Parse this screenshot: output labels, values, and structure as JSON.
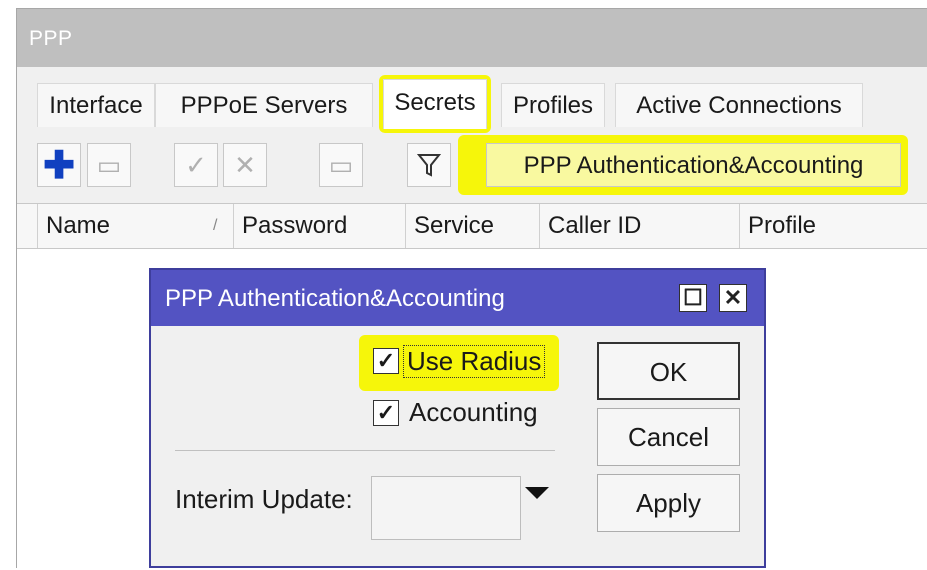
{
  "window": {
    "title": "PPP"
  },
  "tabs": [
    {
      "label": "Interface"
    },
    {
      "label": "PPPoE Servers"
    },
    {
      "label": "Secrets"
    },
    {
      "label": "Profiles"
    },
    {
      "label": "Active Connections"
    }
  ],
  "toolbar": {
    "add_icon": "plus-icon",
    "remove_icon": "minus-icon",
    "enable_icon": "check-icon",
    "disable_icon": "x-icon",
    "comment_icon": "comment-icon",
    "filter_icon": "filter-icon",
    "auth_button_label": "PPP Authentication&Accounting"
  },
  "table": {
    "columns": [
      "Name",
      "Password",
      "Service",
      "Caller ID",
      "Profile"
    ]
  },
  "dialog": {
    "title": "PPP Authentication&Accounting",
    "use_radius_label": "Use Radius",
    "use_radius_checked": true,
    "accounting_label": "Accounting",
    "accounting_checked": true,
    "interim_update_label": "Interim Update:",
    "interim_update_value": "",
    "ok_label": "OK",
    "cancel_label": "Cancel",
    "apply_label": "Apply"
  },
  "colors": {
    "highlight": "#f6f60a",
    "dialog_title_bg": "#5353c2",
    "window_title_bg": "#bfbfbf"
  }
}
